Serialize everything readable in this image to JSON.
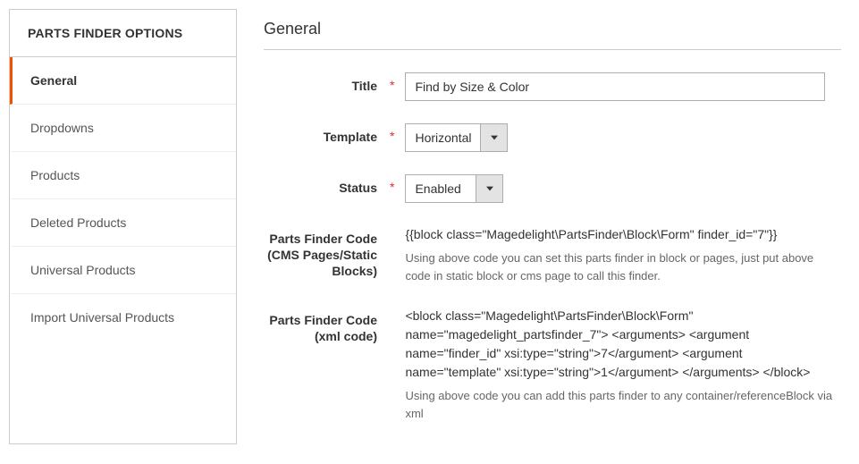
{
  "sidebar": {
    "header": "PARTS FINDER OPTIONS",
    "items": [
      {
        "label": "General",
        "active": true
      },
      {
        "label": "Dropdowns",
        "active": false
      },
      {
        "label": "Products",
        "active": false
      },
      {
        "label": "Deleted Products",
        "active": false
      },
      {
        "label": "Universal Products",
        "active": false
      },
      {
        "label": "Import Universal Products",
        "active": false
      }
    ]
  },
  "section": {
    "title": "General"
  },
  "fields": {
    "title": {
      "label": "Title",
      "value": "Find by Size & Color",
      "required": "*"
    },
    "template": {
      "label": "Template",
      "value": "Horizontal",
      "required": "*"
    },
    "status": {
      "label": "Status",
      "value": "Enabled",
      "required": "*"
    },
    "cms_code": {
      "label": "Parts Finder Code (CMS Pages/Static Blocks)",
      "value": "{{block class=\"Magedelight\\PartsFinder\\Block\\Form\" finder_id=\"7\"}}",
      "help": "Using above code you can set this parts finder in block or pages, just put above code in static block or cms page to call this finder."
    },
    "xml_code": {
      "label": "Parts Finder Code (xml code)",
      "value": "<block class=\"Magedelight\\PartsFinder\\Block\\Form\" name=\"magedelight_partsfinder_7\"> <arguments> <argument name=\"finder_id\" xsi:type=\"string\">7</argument> <argument name=\"template\" xsi:type=\"string\">1</argument> </arguments> </block>",
      "help": "Using above code you can add this parts finder to any container/referenceBlock via xml"
    }
  }
}
